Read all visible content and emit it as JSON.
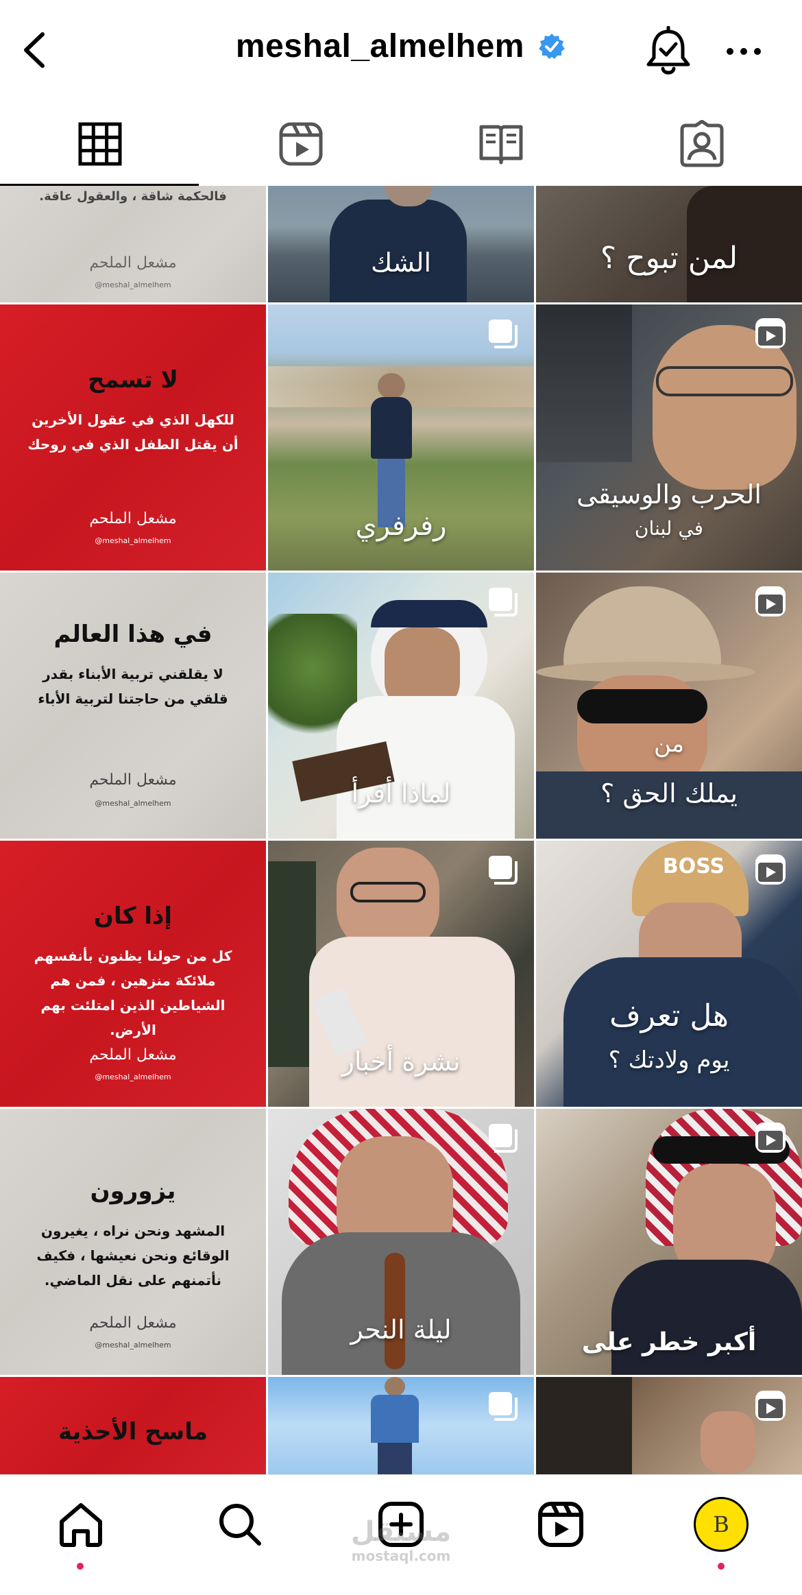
{
  "header": {
    "username": "meshal_almelhem",
    "back_icon": "chevron-left-icon",
    "verified_icon": "verified-badge-icon",
    "bell_icon": "bell-check-icon",
    "more_icon": "more-horizontal-icon"
  },
  "tabs": [
    {
      "name": "tab-posts-grid",
      "icon": "grid-icon",
      "active": true
    },
    {
      "name": "tab-reels",
      "icon": "reels-icon",
      "active": false
    },
    {
      "name": "tab-guides",
      "icon": "guide-book-icon",
      "active": false
    },
    {
      "name": "tab-tagged",
      "icon": "tagged-person-icon",
      "active": false
    }
  ],
  "posts": {
    "r0": {
      "c0": {
        "text": "فالحكمة شاقة ، والعقول عاقة.",
        "sig": "مشعل الملحم",
        "handle": "@meshal_almelhem"
      },
      "c1": {
        "caption": "الشك"
      },
      "c2": {
        "caption": "لمن تبوح ؟"
      }
    },
    "r1": {
      "c0": {
        "title": "لا تسمح",
        "body": "للكهل الذي في عقول الأخرين أن يقتل الطفل الذي في روحك",
        "sig": "مشعل الملحم",
        "handle": "@meshal_almelhem"
      },
      "c1": {
        "caption": "رفرفري",
        "badge": "multiple-posts-icon"
      },
      "c2": {
        "caption": "الحرب والوسيقى",
        "caption2": "في لبنان",
        "badge": "reel-icon"
      }
    },
    "r2": {
      "c0": {
        "title": "في هذا العالم",
        "body": "لا يقلقني تربية الأبناء بقدر قلقي من حاجتنا لتربية الأباء",
        "sig": "مشعل الملحم",
        "handle": "@meshal_almelhem"
      },
      "c1": {
        "caption": "لماذا أقرأ",
        "badge": "multiple-posts-icon"
      },
      "c2": {
        "caption": "من",
        "caption2": "يملك الحق ؟",
        "badge": "reel-icon"
      }
    },
    "r3": {
      "c0": {
        "title": "إذا كان",
        "body": "كل من حولنا يظنون بأنفسهم ملائكة منزهين ، فمن هم الشياطين الذين امتلئت بهم الأرض.",
        "sig": "مشعل الملحم",
        "handle": "@meshal_almelhem"
      },
      "c1": {
        "caption": "نشرة أخبار",
        "badge": "multiple-posts-icon"
      },
      "c2": {
        "caption": "هل تعرف",
        "caption2": "يوم ولادتك ؟",
        "badge": "reel-icon",
        "cap_text": "BOSS"
      }
    },
    "r4": {
      "c0": {
        "title": "يزورون",
        "body": "المشهد ونحن نراه ، يغيرون الوقائع ونحن نعيشها ، فكيف نأتمنهم على نقل الماضي.",
        "sig": "مشعل الملحم",
        "handle": "@meshal_almelhem"
      },
      "c1": {
        "caption": "ليلة النحر",
        "badge": "multiple-posts-icon"
      },
      "c2": {
        "caption": "أكبر خطر على",
        "badge": "reel-icon"
      }
    },
    "r5": {
      "c0": {
        "title": "ماسح الأحذية"
      },
      "c1": {
        "badge": "multiple-posts-icon"
      },
      "c2": {
        "badge": "reel-icon"
      }
    }
  },
  "bottom_nav": [
    {
      "name": "nav-home",
      "icon": "home-icon",
      "active": true
    },
    {
      "name": "nav-search",
      "icon": "search-icon",
      "active": false
    },
    {
      "name": "nav-create",
      "icon": "plus-square-icon",
      "active": false
    },
    {
      "name": "nav-reels",
      "icon": "reels-icon",
      "active": false
    },
    {
      "name": "nav-profile",
      "icon": "avatar",
      "active": false
    }
  ],
  "avatar_letter": "B",
  "watermark": {
    "line1": "مستقل",
    "line2": "mostaql.com"
  },
  "colors": {
    "accent_blue": "#3897f0",
    "red_bg": "#d61e26",
    "notification_dot": "#e0245e"
  }
}
